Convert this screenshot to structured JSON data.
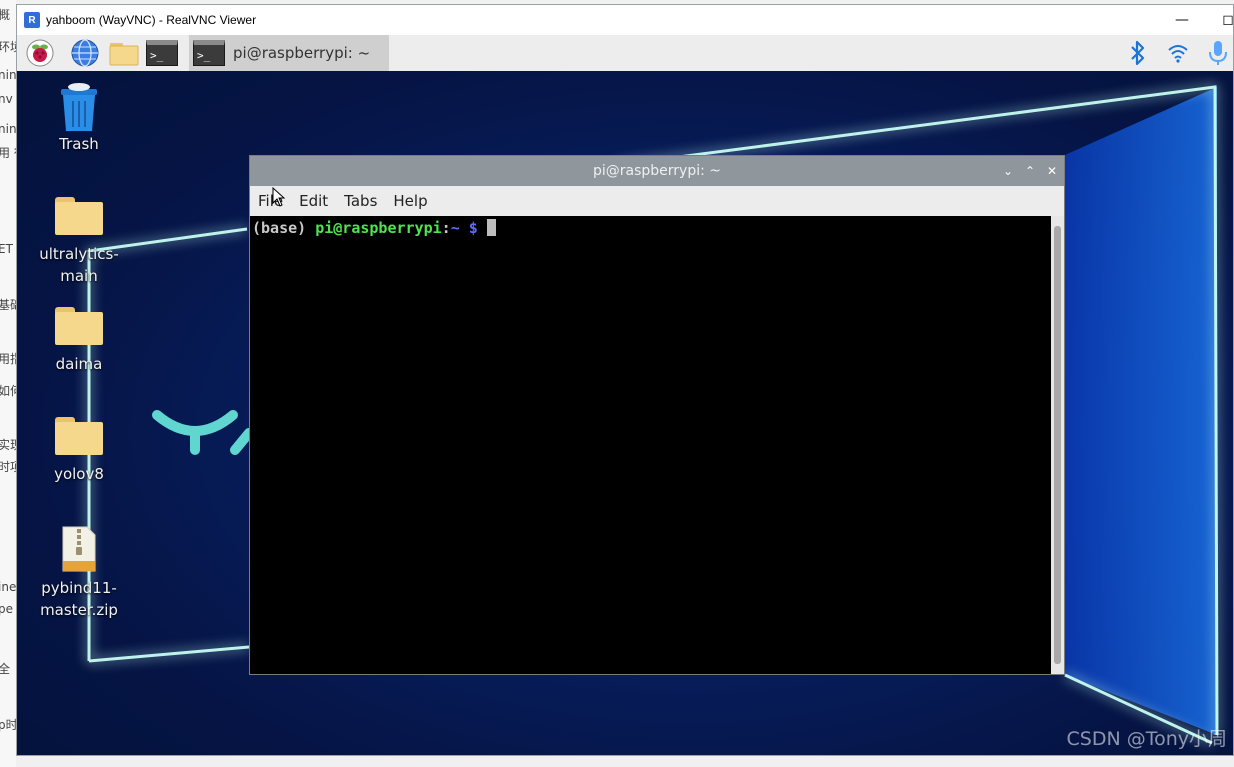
{
  "vnc": {
    "title": "yahboom (WayVNC) - RealVNC Viewer",
    "logo_text": "R"
  },
  "panel": {
    "active_task": "pi@raspberrypi: ~",
    "icons": [
      "raspberry-menu-icon",
      "browser-globe-icon",
      "file-manager-icon",
      "terminal-icon"
    ],
    "tray": [
      "bluetooth-icon",
      "wifi-icon",
      "microphone-icon"
    ]
  },
  "desktop": {
    "icons": [
      {
        "label": "Trash",
        "type": "trash"
      },
      {
        "label": "ultralytics-main",
        "type": "folder"
      },
      {
        "label": "daima",
        "type": "folder"
      },
      {
        "label": "yolov8",
        "type": "folder"
      },
      {
        "label": "pybind11-master.zip",
        "type": "zip"
      }
    ]
  },
  "terminal": {
    "title": "pi@raspberrypi: ~",
    "menu": [
      "File",
      "Edit",
      "Tabs",
      "Help"
    ],
    "prompt": {
      "env": "(base)",
      "userhost": "pi@raspberrypi",
      "colon": ":",
      "path": "~",
      "symbol": "$"
    },
    "colors": {
      "env": "#c9c9c9",
      "userhost": "#4ee44e",
      "path": "#5b6cff",
      "symbol": "#5b6cff"
    }
  },
  "watermark": "CSDN @Tony小周",
  "behind_fragments": [
    "概",
    "环境",
    "nin",
    "nv",
    "nin",
    "用 征",
    "ET",
    "基础",
    "用指",
    "如何",
    "实现",
    "时项",
    "ine",
    "pe",
    "全",
    "p时"
  ]
}
